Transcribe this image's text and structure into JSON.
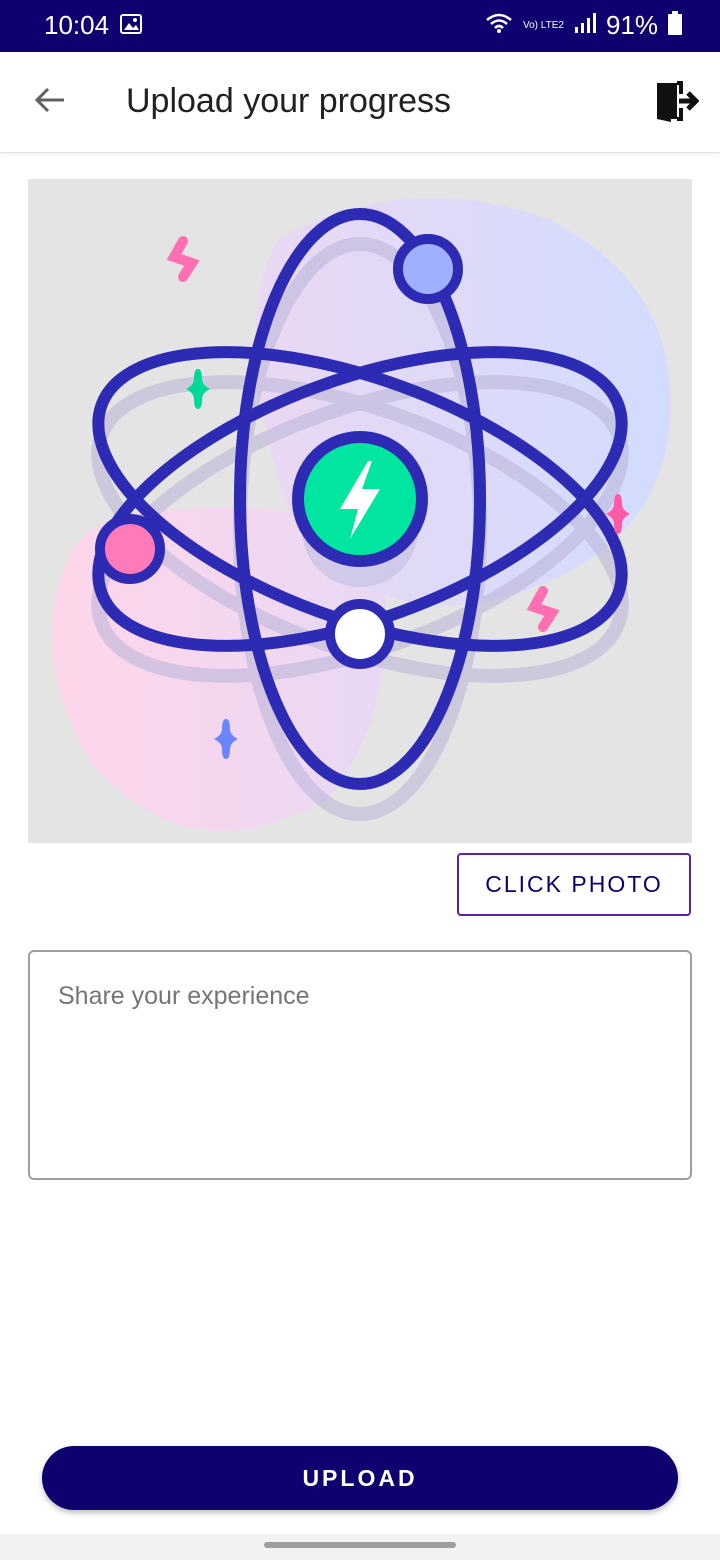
{
  "status_bar": {
    "time": "10:04",
    "network_label": "Vo) LTE2",
    "battery_percent": "91%",
    "icons": [
      "gallery-icon",
      "wifi-icon",
      "signal-icon",
      "battery-icon"
    ]
  },
  "app_bar": {
    "title": "Upload your progress",
    "back_icon": "arrow-left-icon",
    "logout_icon": "exit-door-icon"
  },
  "illustration": {
    "subject": "atom",
    "colors": {
      "orbit": "#2d2bb3",
      "core": "#00e5a0",
      "accent_pink": "#ff7ab8",
      "accent_blue": "#a0b0ff"
    }
  },
  "click_photo": {
    "label": "CLICK PHOTO"
  },
  "experience": {
    "placeholder": "Share your experience",
    "value": ""
  },
  "upload": {
    "label": "UPLOAD"
  },
  "theme": {
    "primary": "#0f0070",
    "outline": "#5b1fa8"
  }
}
